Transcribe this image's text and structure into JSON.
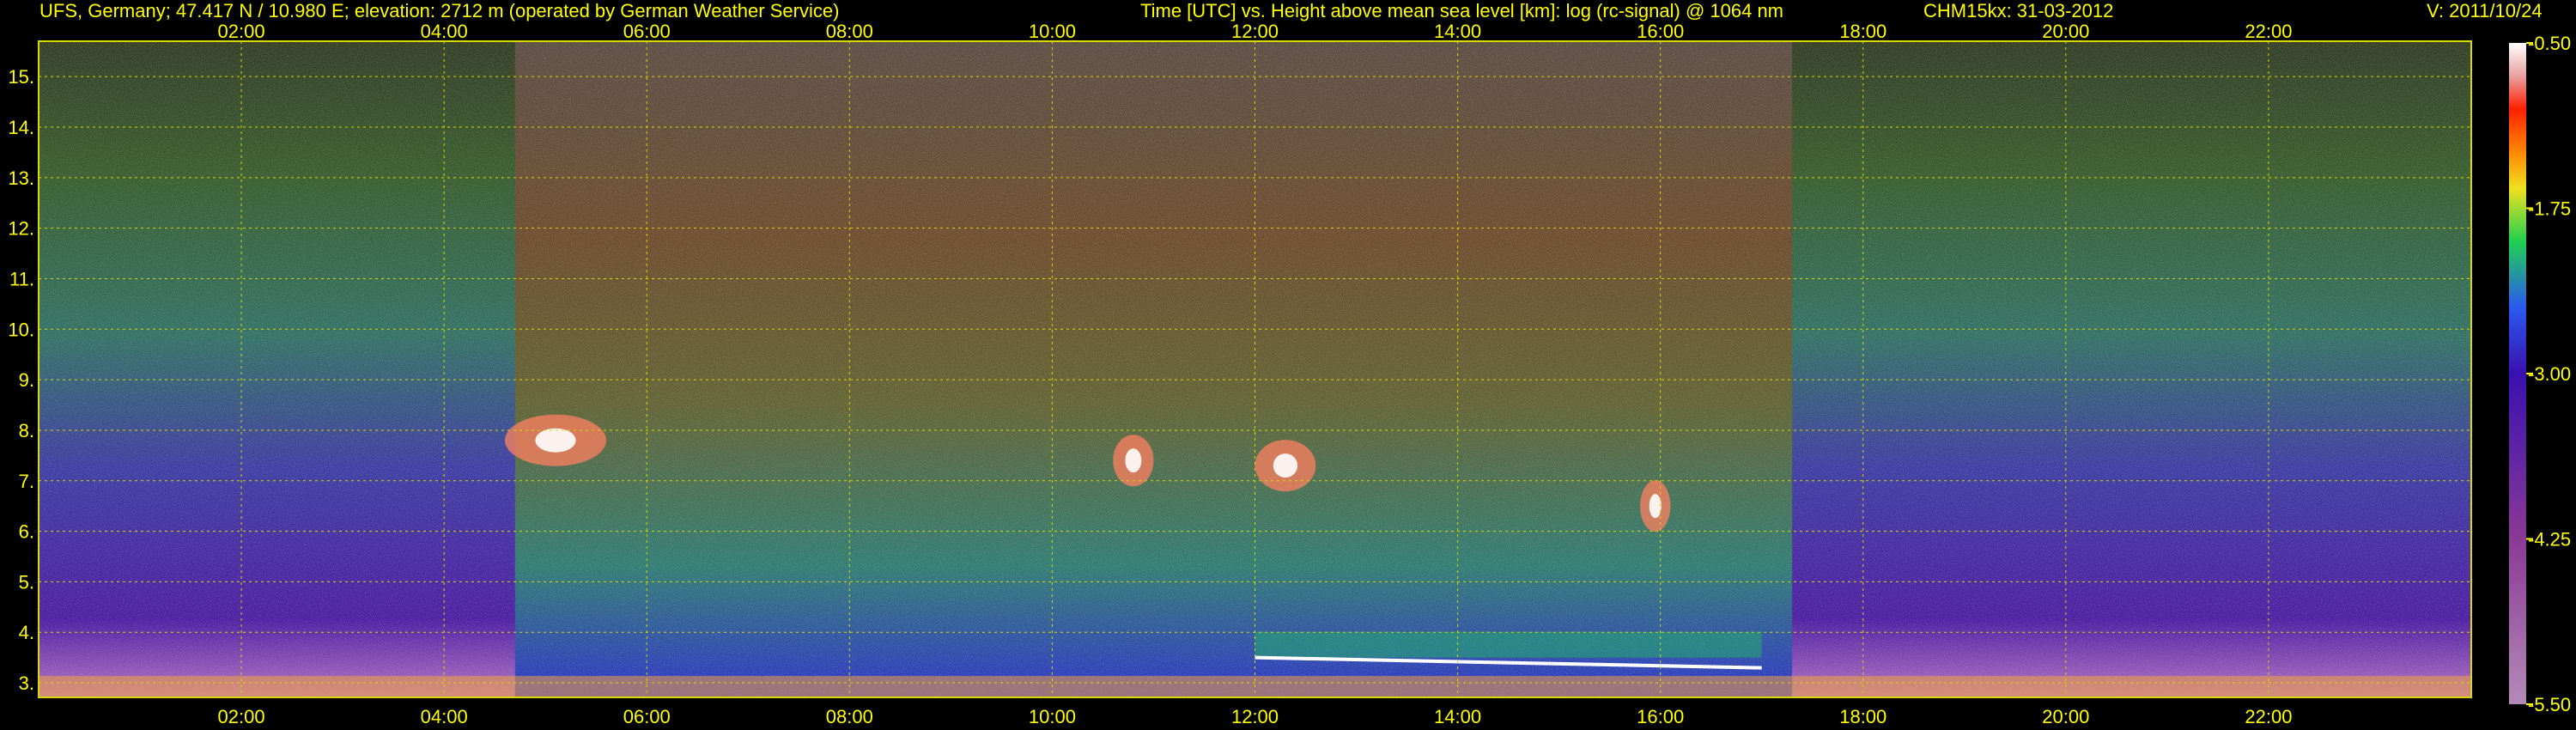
{
  "header": {
    "station": "UFS, Germany; 47.417 N / 10.980 E; elevation: 2712 m  (operated by German Weather Service)",
    "axes_title": "Time [UTC] vs. Height above mean sea level [km]: log (rc-signal) @ 1064 nm",
    "instrument": "CHM15kx: 31-03-2012",
    "version": "V: 2011/10/24"
  },
  "colors": {
    "text": "#ffff00",
    "grid": "#d9d900",
    "background": "#000000"
  },
  "chart_data": {
    "type": "heatmap",
    "title": "Time [UTC] vs. Height above mean sea level [km]: log (rc-signal) @ 1064 nm",
    "xlabel": "",
    "ylabel": "",
    "xlim": [
      0,
      24
    ],
    "ylim": [
      2.712,
      15.7
    ],
    "x_ticks": [
      2,
      4,
      6,
      8,
      10,
      12,
      14,
      16,
      18,
      20,
      22
    ],
    "x_tick_labels": [
      "02:00",
      "04:00",
      "06:00",
      "08:00",
      "10:00",
      "12:00",
      "14:00",
      "16:00",
      "18:00",
      "20:00",
      "22:00"
    ],
    "y_ticks": [
      3,
      4,
      5,
      6,
      7,
      8,
      9,
      10,
      11,
      12,
      13,
      14,
      15
    ],
    "y_tick_labels": [
      "3.",
      "4.",
      "5.",
      "6.",
      "7.",
      "8.",
      "9.",
      "10.",
      "11.",
      "12.",
      "13.",
      "14.",
      "15."
    ],
    "grid": true,
    "colorbar": {
      "range": [
        -5.5,
        -0.5
      ],
      "ticks": [
        -0.5,
        -1.75,
        -3.0,
        -4.25,
        -5.5
      ],
      "tick_labels": [
        "-0.50",
        "-1.75",
        "-3.00",
        "-4.25",
        "-5.50"
      ]
    },
    "features": [
      {
        "name": "daytime-noise",
        "t_start": 4.7,
        "t_end": 17.3
      },
      {
        "name": "boundary-layer-top",
        "t_start": 12.0,
        "t_end": 17.0,
        "height_km": 3.5
      },
      {
        "name": "cloud",
        "t_start": 4.6,
        "t_end": 5.6,
        "height_km": 7.8
      },
      {
        "name": "cloud",
        "t_start": 10.6,
        "t_end": 11.0,
        "height_km": 7.4
      },
      {
        "name": "cloud",
        "t_start": 12.0,
        "t_end": 12.6,
        "height_km": 7.3
      },
      {
        "name": "cloud",
        "t_start": 15.8,
        "t_end": 16.1,
        "height_km": 6.5
      }
    ]
  }
}
